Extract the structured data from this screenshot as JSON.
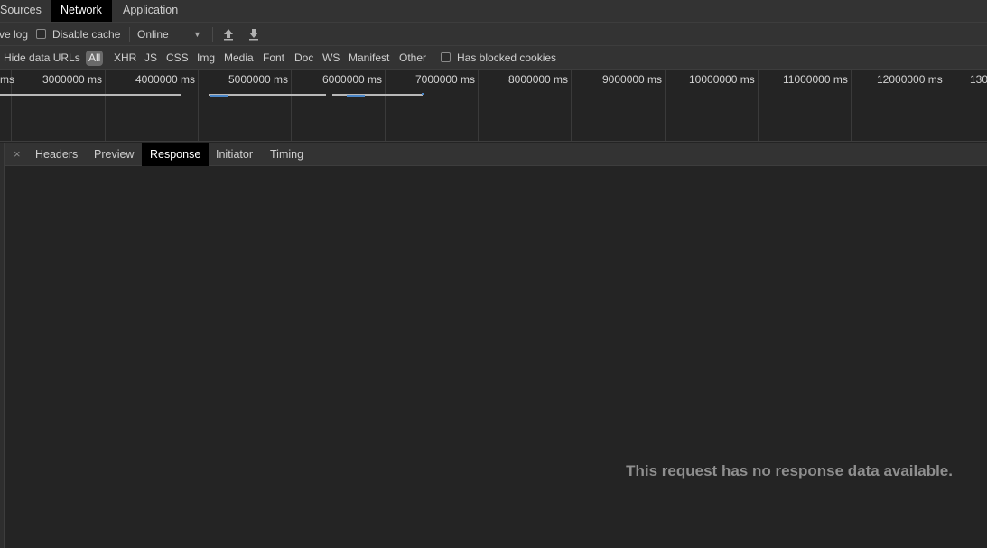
{
  "tabs": {
    "sources": "Sources",
    "network": "Network",
    "application": "Application"
  },
  "toolbar": {
    "preserve_log": "ve log",
    "disable_cache": "Disable cache",
    "throttling": "Online",
    "throttling_arrow": "▼"
  },
  "filters": {
    "hide_data_urls": "Hide data URLs",
    "types": [
      "All",
      "XHR",
      "JS",
      "CSS",
      "Img",
      "Media",
      "Font",
      "Doc",
      "WS",
      "Manifest",
      "Other"
    ],
    "has_blocked_cookies": "Has blocked cookies"
  },
  "timeline": {
    "ticks": [
      "ms",
      "3000000 ms",
      "4000000 ms",
      "5000000 ms",
      "6000000 ms",
      "7000000 ms",
      "8000000 ms",
      "9000000 ms",
      "10000000 ms",
      "11000000 ms",
      "12000000 ms",
      "130"
    ]
  },
  "detail": {
    "close": "×",
    "tabs": [
      "Headers",
      "Preview",
      "Response",
      "Initiator",
      "Timing"
    ],
    "active_tab": "Response",
    "empty_message": "This request has no response data available."
  },
  "colors": {
    "active_tab_bg": "#000000",
    "panel_bg": "#242424",
    "toolbar_bg": "#333333",
    "timeline_blue": "#4a86c8"
  }
}
